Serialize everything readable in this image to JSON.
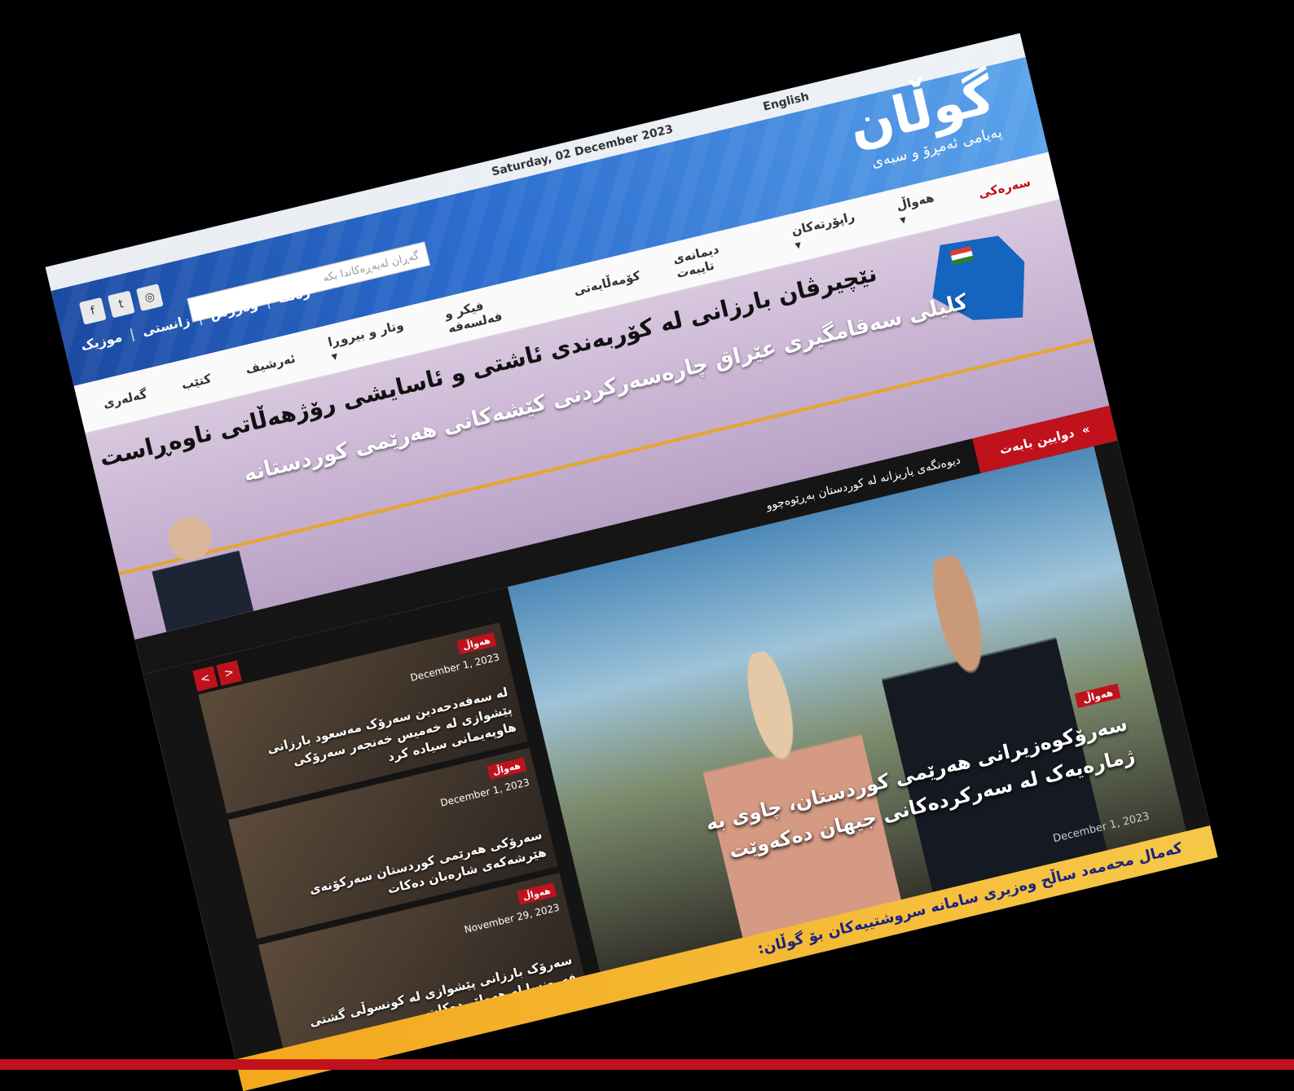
{
  "topbar": {
    "date": "Saturday, 02 December 2023",
    "language": "English"
  },
  "logo": {
    "name": "گوڵان",
    "slogan": "پەیامی ئەمڕۆ و سبەی"
  },
  "social": [
    "f",
    "t",
    "◎"
  ],
  "toplinks": [
    "موزیک",
    "زانستی",
    "وەرزش",
    "رەنگا"
  ],
  "search": {
    "placeholder": "گەڕان لەپەڕەکاندا بکە"
  },
  "nav": {
    "items": [
      {
        "label": "سەرەکی",
        "active": true
      },
      {
        "label": "هەواڵ ▾",
        "active": false
      },
      {
        "label": "راپۆرتەکان ▾",
        "active": false
      },
      {
        "label": "دیمانەی تایبەت",
        "active": false
      },
      {
        "label": "کۆمەڵایەتی",
        "active": false
      },
      {
        "label": "فیکر و فەلسەفە",
        "active": false
      },
      {
        "label": "وتار و بیروڕا ▾",
        "active": false
      },
      {
        "label": "ئەرشیف",
        "active": false
      },
      {
        "label": "کتێب",
        "active": false
      },
      {
        "label": "گەلەری",
        "active": false
      }
    ]
  },
  "banner": {
    "headline": "نێچیرڤان بارزانی  لە کۆربەندی ئاشتی و ئاسایشی رۆژهەڵاتی ناوەڕاست :",
    "line1": "کلیلی سەقامگیری عێراق چارەسەرکردنی کێشەکانی هەرێمی کوردستانە"
  },
  "breaking": {
    "label": "دوایین بابەت",
    "text": "ديوەنگەی یاریزانە لە کوردستان بەڕێوەچوو"
  },
  "side_nav": {
    "prev": "<",
    "next": ">"
  },
  "side_items": [
    {
      "tag": "هەواڵ",
      "date": "December 1, 2023",
      "title": "لە سەفەدحەدین سەرۆک مەسعود بارزانی پێشوازی لە خەمیس خەنجەر سەرۆکی هاوپەیمانی سیادە کرد"
    },
    {
      "tag": "هەواڵ",
      "date": "December 1, 2023",
      "title": "سەرۆکی هەرێمی کوردستان سەرکۆنەی هێرشەکەی شارەبان دەکات"
    },
    {
      "tag": "هەواڵ",
      "date": "November 29, 2023",
      "title": "سەرۆک بارزانی پێشوازی لە کونسوڵی گشتی فەرەنسا لە هەولێر دەکات"
    }
  ],
  "main_story": {
    "tag": "هەواڵ",
    "title": "سەرۆکوەزیرانی هەرێمی کوردستان، چاوی بە ژمارەیەک لە سەرکردەکانی جیهان دەکەوێت",
    "date": "December 1, 2023"
  },
  "oil_banner": {
    "text": "کەمال محەمەد ساڵح وەزیری سامانە سروشتییەکان بۆ گوڵان:"
  },
  "colors": {
    "accent": "#c0121c",
    "header_blue": "#1b4aa3",
    "banner_purple": "#c7b2d1",
    "oil_orange": "#f4a71d"
  }
}
